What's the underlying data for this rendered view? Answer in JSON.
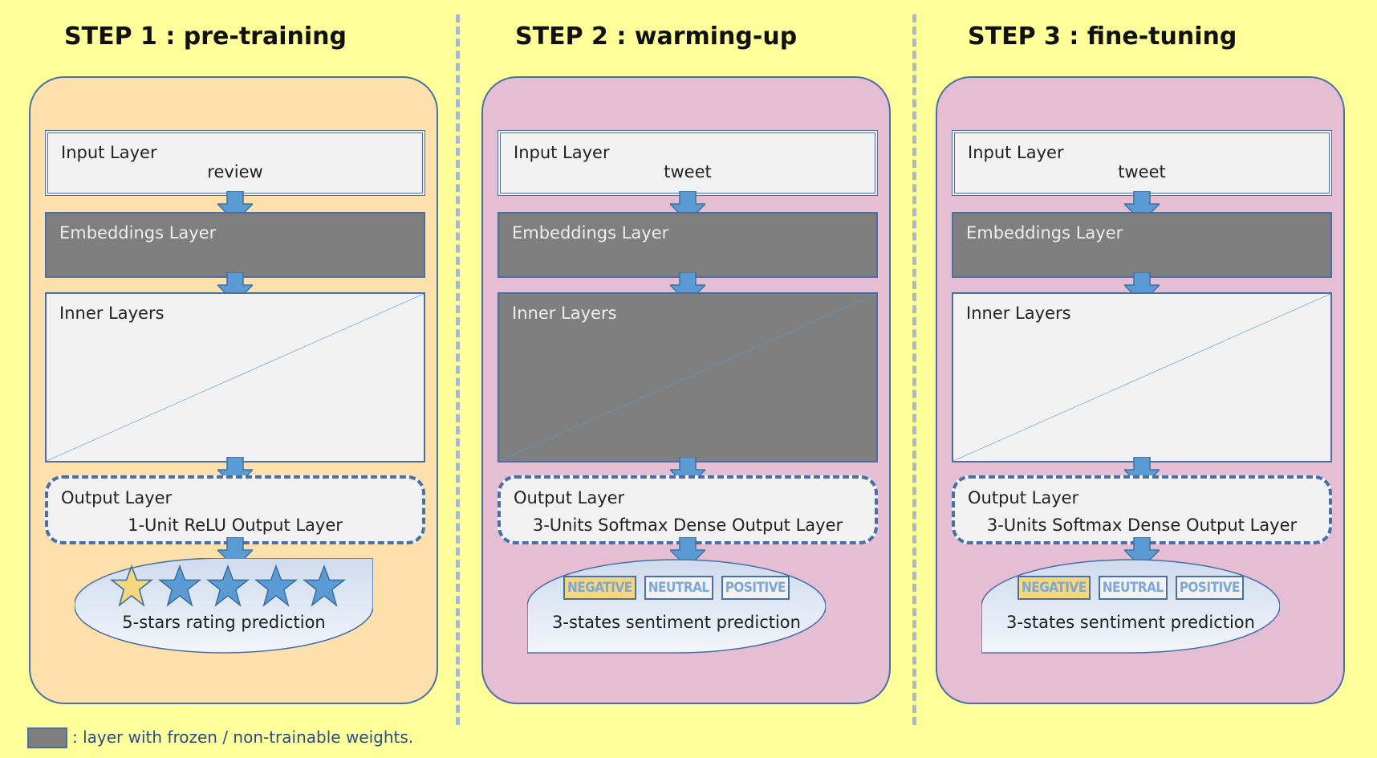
{
  "colors": {
    "background": "#ffff99",
    "step1_panel": "#fde0ab",
    "step2_panel": "#e5bed4",
    "frozen_layer": "#7f7f7f",
    "trainable_layer": "#f2f2f2",
    "arrow": "#5b9bd5",
    "border": "#4a6fa5"
  },
  "steps": [
    {
      "title": "STEP 1 : pre-training",
      "input": {
        "name": "Input Layer",
        "value": "review"
      },
      "embeddings": {
        "name": "Embeddings Layer",
        "frozen": true
      },
      "inner": {
        "name": "Inner Layers",
        "frozen": false
      },
      "output": {
        "name": "Output Layer",
        "value": "1-Unit ReLU Output Layer"
      },
      "prediction": {
        "label": "5-stars rating prediction",
        "stars_total": 5,
        "stars_highlighted": 1
      }
    },
    {
      "title": "STEP 2 : warming-up",
      "input": {
        "name": "Input Layer",
        "value": "tweet"
      },
      "embeddings": {
        "name": "Embeddings Layer",
        "frozen": true
      },
      "inner": {
        "name": "Inner Layers",
        "frozen": true
      },
      "output": {
        "name": "Output Layer",
        "value": "3-Units Softmax Dense Output Layer"
      },
      "prediction": {
        "label": "3-states sentiment prediction",
        "tags": [
          "NEGATIVE",
          "NEUTRAL",
          "POSITIVE"
        ]
      }
    },
    {
      "title": "STEP 3 : fine-tuning",
      "input": {
        "name": "Input Layer",
        "value": "tweet"
      },
      "embeddings": {
        "name": "Embeddings Layer",
        "frozen": true
      },
      "inner": {
        "name": "Inner Layers",
        "frozen": false
      },
      "output": {
        "name": "Output Layer",
        "value": "3-Units Softmax Dense Output Layer"
      },
      "prediction": {
        "label": "3-states sentiment prediction",
        "tags": [
          "NEGATIVE",
          "NEUTRAL",
          "POSITIVE"
        ]
      }
    }
  ],
  "legend": {
    "text": ": layer with frozen / non-trainable weights."
  }
}
